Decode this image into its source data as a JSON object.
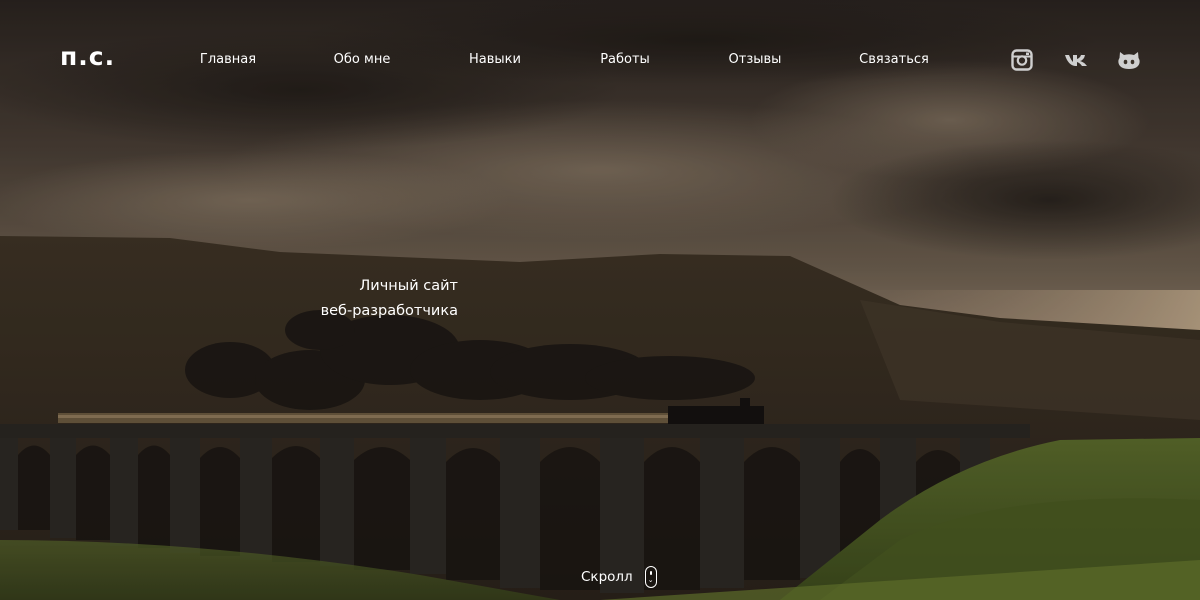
{
  "header": {
    "logo": "п.с.",
    "nav": [
      {
        "label": "Главная"
      },
      {
        "label": "Обо мне"
      },
      {
        "label": "Навыки"
      },
      {
        "label": "Работы"
      },
      {
        "label": "Отзывы"
      },
      {
        "label": "Связаться"
      }
    ],
    "social": [
      {
        "icon": "instagram-icon"
      },
      {
        "icon": "vk-icon"
      },
      {
        "icon": "github-icon"
      }
    ]
  },
  "hero": {
    "tagline_line1": "Личный сайт",
    "tagline_line2": "веб-разработчика",
    "scroll_label": "Скролл",
    "colors": {
      "sky": "#4a4038",
      "hills": "#3d3126",
      "viaduct": "#2d2925",
      "grass": "#5a6a2a",
      "text": "#ffffff"
    }
  }
}
